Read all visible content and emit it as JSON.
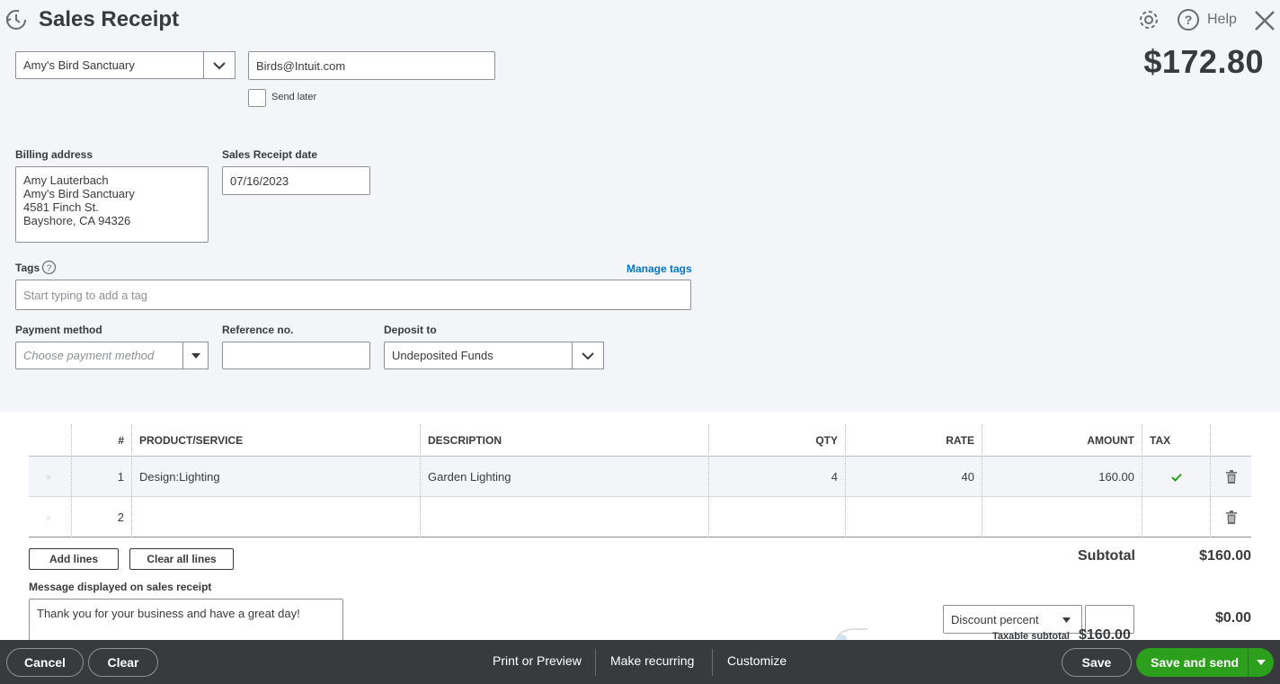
{
  "header": {
    "title": "Sales Receipt",
    "help_label": "Help",
    "total_amount": "$172.80"
  },
  "customer": {
    "name": "Amy's Bird Sanctuary",
    "email": "Birds@Intuit.com",
    "send_later_label": "Send later"
  },
  "billing": {
    "label": "Billing address",
    "lines": [
      "Amy Lauterbach",
      "Amy's Bird Sanctuary",
      "4581 Finch St.",
      "Bayshore, CA  94326"
    ]
  },
  "receipt_date": {
    "label": "Sales Receipt date",
    "value": "07/16/2023"
  },
  "tags": {
    "label": "Tags",
    "manage_link": "Manage tags",
    "placeholder": "Start typing to add a tag"
  },
  "payment": {
    "method_label": "Payment method",
    "method_placeholder": "Choose payment method",
    "reference_label": "Reference no.",
    "reference_value": "",
    "deposit_label": "Deposit to",
    "deposit_value": "Undeposited Funds"
  },
  "table": {
    "columns": [
      "#",
      "PRODUCT/SERVICE",
      "DESCRIPTION",
      "QTY",
      "RATE",
      "AMOUNT",
      "TAX"
    ],
    "rows": [
      {
        "num": "1",
        "product": "Design:Lighting",
        "description": "Garden Lighting",
        "qty": "4",
        "rate": "40",
        "amount": "160.00",
        "tax": true
      },
      {
        "num": "2",
        "product": "",
        "description": "",
        "qty": "",
        "rate": "",
        "amount": "",
        "tax": false
      }
    ]
  },
  "actions": {
    "add_lines": "Add lines",
    "clear_all_lines": "Clear all lines"
  },
  "totals": {
    "subtotal_label": "Subtotal",
    "subtotal_value": "$160.00",
    "discount_select": "Discount percent",
    "discount_value": "$0.00",
    "taxable_subtotal_label": "Taxable subtotal",
    "taxable_subtotal_value": "$160.00"
  },
  "message": {
    "label": "Message displayed on sales receipt",
    "value": "Thank you for your business and have a great day!"
  },
  "footer": {
    "cancel": "Cancel",
    "clear": "Clear",
    "print_preview": "Print or Preview",
    "make_recurring": "Make recurring",
    "customize": "Customize",
    "save": "Save",
    "save_and_send": "Save and send"
  },
  "colors": {
    "accent_green": "#2ca01c",
    "link_blue": "#0077c5",
    "footer_bg": "#393a3d"
  }
}
